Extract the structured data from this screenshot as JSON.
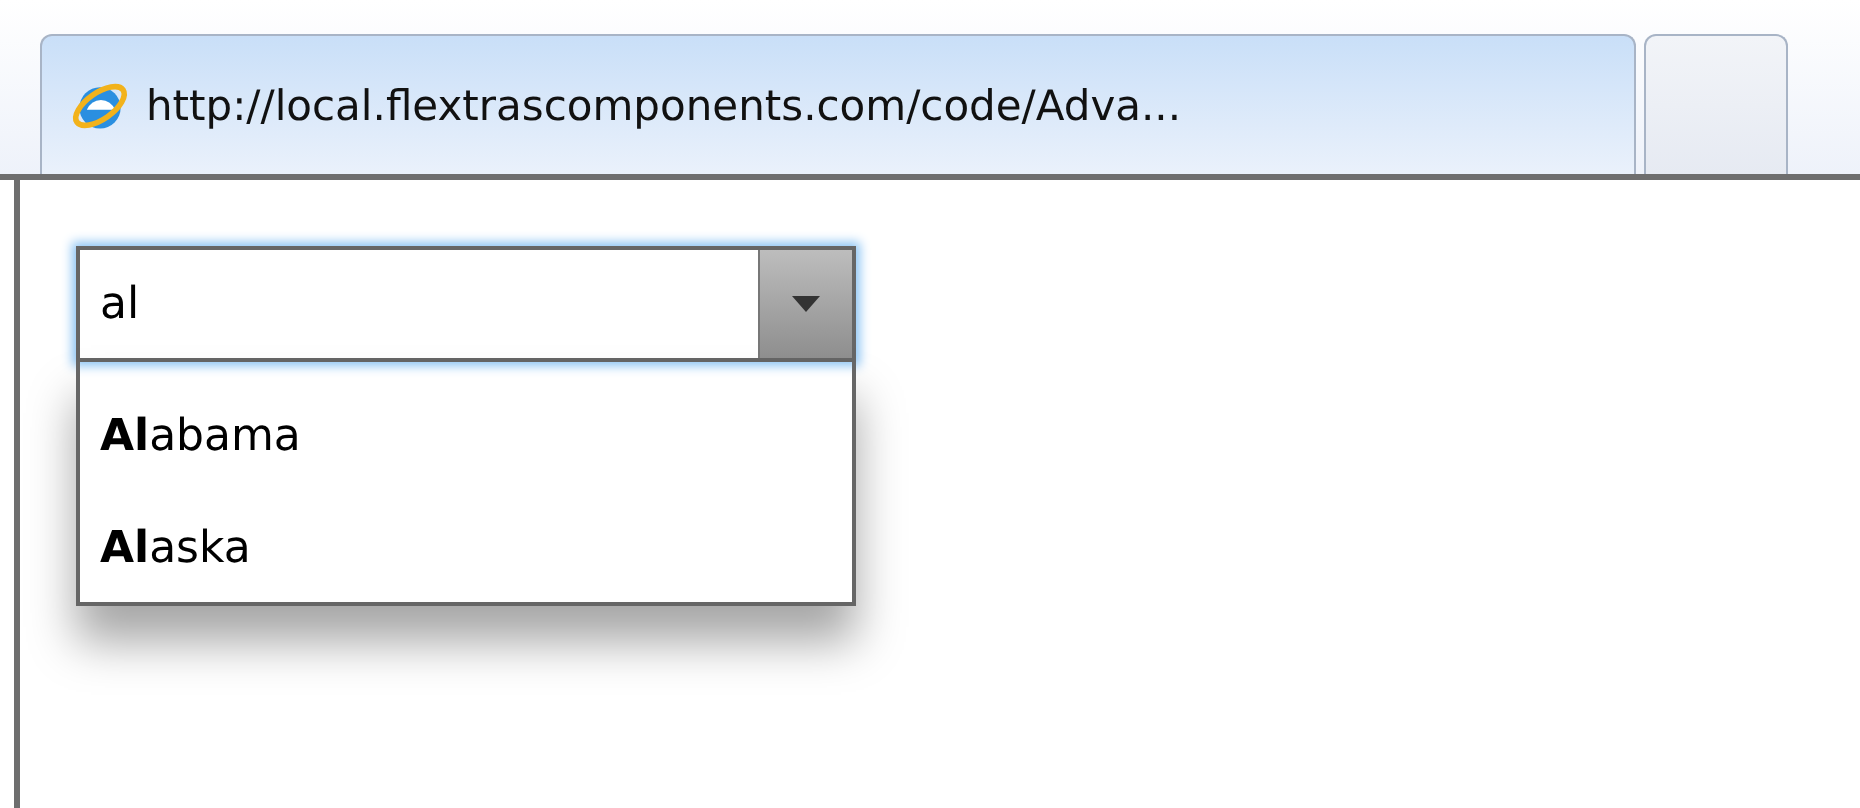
{
  "tabs": [
    {
      "label": "http://local.flextrascomponents.com/code/Adva...",
      "selected": true
    },
    {
      "selected": false
    }
  ],
  "combo": {
    "value": "al",
    "options": [
      "**Al**abama",
      "**Al**aska"
    ]
  }
}
